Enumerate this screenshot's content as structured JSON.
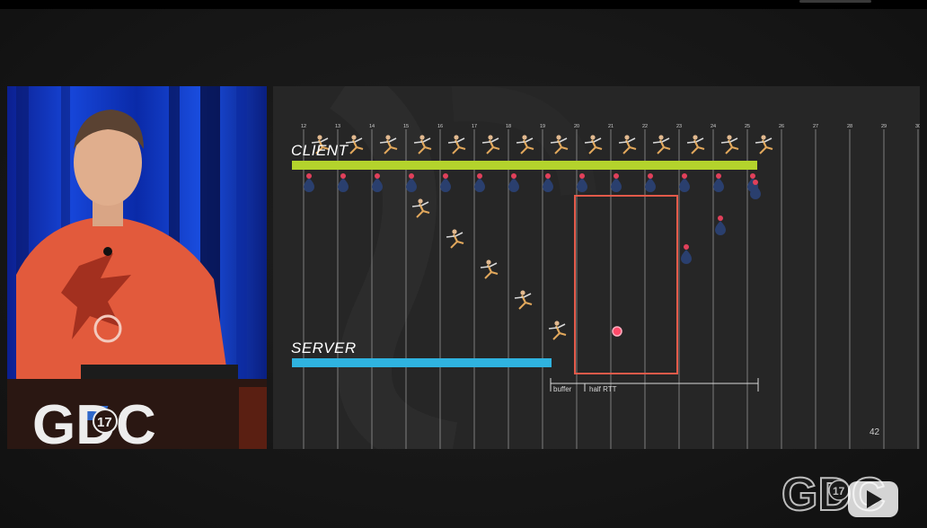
{
  "slide": {
    "client_label": "CLIENT",
    "server_label": "SERVER",
    "tick_numbers": [
      "12",
      "13",
      "14",
      "15",
      "16",
      "17",
      "18",
      "19",
      "20",
      "21",
      "22",
      "23",
      "24",
      "25",
      "26",
      "27",
      "28",
      "29",
      "30"
    ],
    "annotations": {
      "buffer": "buffer",
      "half_rtt": "half RTT"
    },
    "page_number": "42",
    "colors": {
      "client_bar": "#b4d32c",
      "server_bar": "#2fb3e0",
      "highlight_box": "#e35a4a",
      "background": "#262626"
    }
  },
  "camera": {
    "logo_text": "GDC",
    "logo_number": "17"
  },
  "watermark": {
    "logo_text": "GDC",
    "logo_number": "17"
  },
  "controls": {
    "play_icon": "play-icon"
  }
}
